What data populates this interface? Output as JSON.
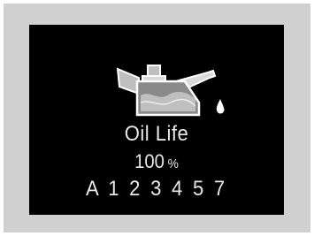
{
  "display": {
    "icon": "oil-can-icon",
    "title": "Oil Life",
    "percentage": "100",
    "unit": "%",
    "maintenance_codes": "A 1 2 3 4 5 7"
  },
  "colors": {
    "screen_bg": "#000000",
    "frame_bg": "#d0d0d0",
    "text": "#e8e8e8"
  }
}
